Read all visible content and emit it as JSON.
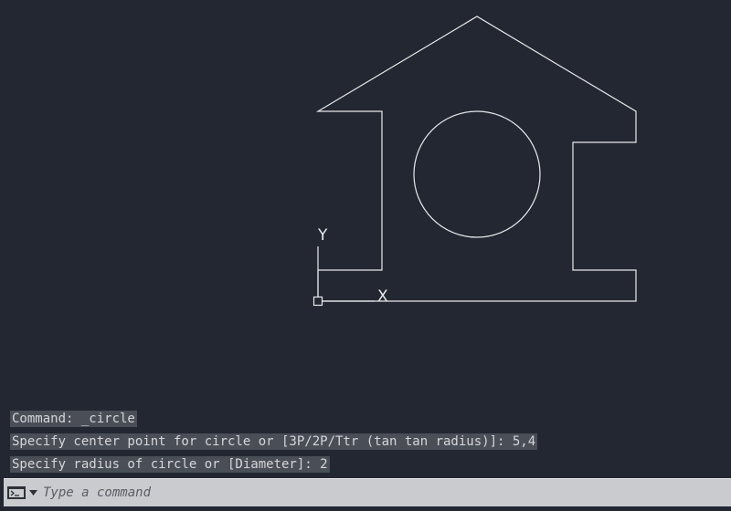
{
  "app": {
    "canvas_bg": "#222731",
    "line_color": "#e8e9ea"
  },
  "ucs": {
    "y_label": "Y",
    "x_label": "X"
  },
  "command_history": [
    {
      "text": "Command: _circle"
    },
    {
      "text": "Specify center point for circle or [3P/2P/Ttr (tan tan radius)]: 5,4"
    },
    {
      "text": "Specify radius of circle or [Diameter]: 2"
    }
  ],
  "command_line": {
    "placeholder": "Type a command",
    "value": "",
    "icon": "terminal-icon",
    "dropdown_icon": "caret-down-icon"
  }
}
